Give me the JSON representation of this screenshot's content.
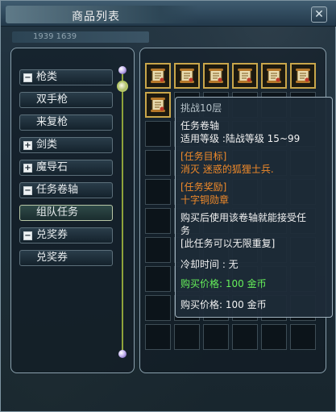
{
  "window": {
    "title": "商品列表",
    "close_glyph": "✕",
    "subbar_text": "1939  1639"
  },
  "categories": [
    {
      "label": "枪类",
      "sign": "−",
      "type": "category"
    },
    {
      "label": "双手枪",
      "type": "sub"
    },
    {
      "label": "来复枪",
      "type": "sub"
    },
    {
      "label": "剑类",
      "sign": "+",
      "type": "category"
    },
    {
      "label": "魔导石",
      "sign": "+",
      "type": "category"
    },
    {
      "label": "任务卷轴",
      "sign": "−",
      "type": "category"
    },
    {
      "label": "组队任务",
      "type": "sub",
      "selected": true
    },
    {
      "label": "兑奖券",
      "sign": "−",
      "type": "category"
    },
    {
      "label": "兑奖券",
      "type": "sub"
    }
  ],
  "grid": {
    "columns": 6,
    "rows": 10,
    "filled_count": 7,
    "item_icon": "quest-scroll-icon"
  },
  "tooltip": {
    "item_name": "挑战10层",
    "item_type": "任务卷轴",
    "requirement": "适用等级 :陆战等级 15~99",
    "goal_header": "[任务目标]",
    "goal_text": "消灭 迷惑的狐狸士兵.",
    "reward_header": "[任务奖励]",
    "reward_text": "十字铜勋章",
    "desc_line1": "购买后使用该卷轴就能接受任",
    "desc_line2": "务",
    "desc_line3": "[此任务可以无限重复]",
    "cooldown": "冷却时间 : 无",
    "price1": "购买价格: 100 金币",
    "price2": "购买价格: 100 金币"
  },
  "colors": {
    "accent_orange": "#f08a2a",
    "accent_green": "#66f05a",
    "item_border_gold": "#c9a64a",
    "scrollbar": "#8ea33a"
  }
}
